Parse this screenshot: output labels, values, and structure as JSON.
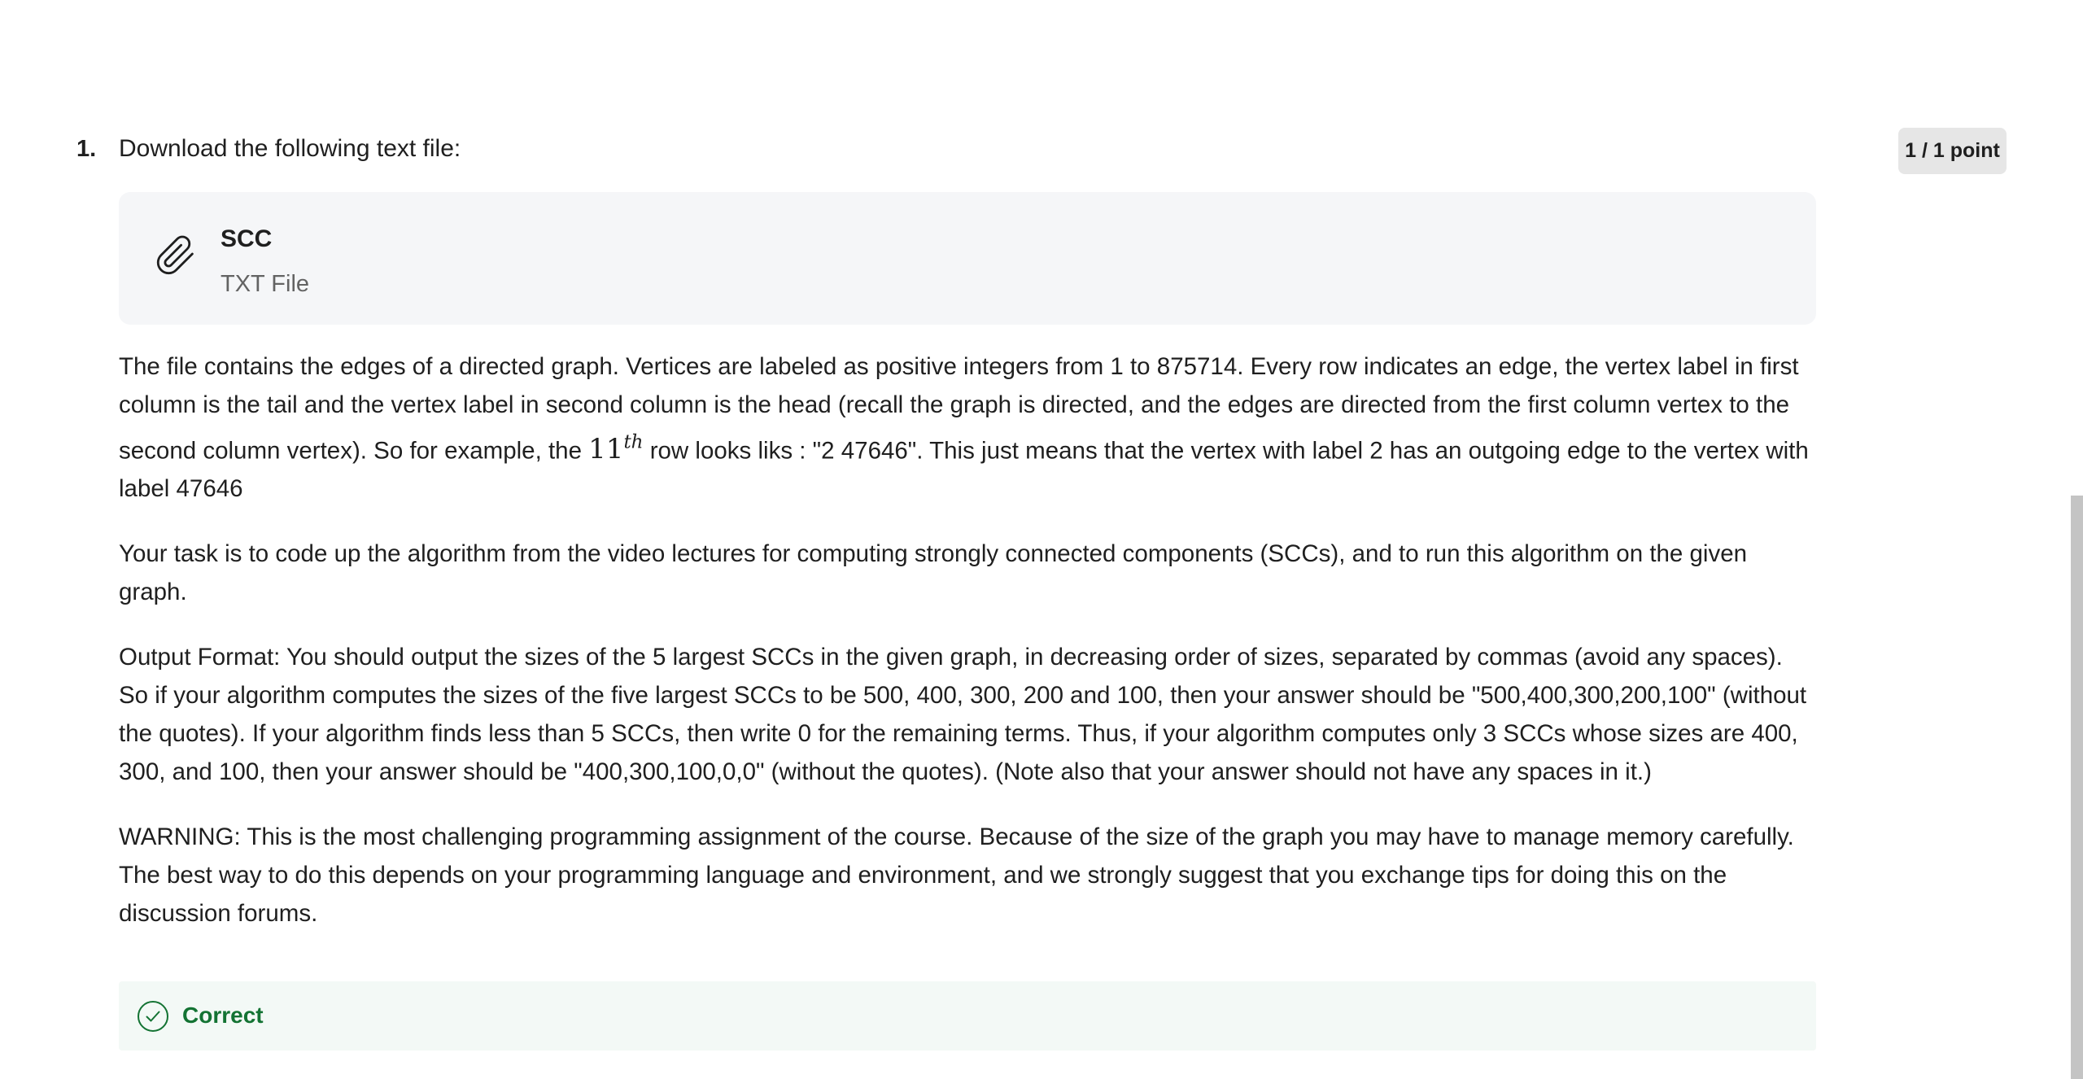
{
  "question": {
    "number": "1.",
    "points": "1 / 1 point",
    "prompt": "Download the following text file:",
    "attachment": {
      "title": "SCC",
      "type": "TXT File",
      "icon": "paperclip-icon"
    },
    "paragraphs": {
      "p1_part1": "The file contains the edges of a directed graph. Vertices are labeled as positive integers from 1 to 875714. Every row indicates an edge, the vertex label in first column is the tail and the vertex label in second column is the head (recall the graph is directed, and the edges are directed from the first column vertex to the second column vertex). So for example, the ",
      "p1_math_base": "11",
      "p1_math_sup": "th",
      "p1_part2": " row looks liks : \"2 47646\". This just means that the vertex with label 2 has an outgoing edge to the vertex with label 47646",
      "p2": "Your task is to code up the algorithm from the video lectures for computing strongly connected components (SCCs), and to run this algorithm on the given graph.",
      "p3": "Output Format: You should output the sizes of the 5 largest SCCs in the given graph, in decreasing order of sizes, separated by commas (avoid any spaces). So if your algorithm computes the sizes of the five largest SCCs to be 500, 400, 300, 200 and 100, then your answer should be \"500,400,300,200,100\" (without the quotes). If your algorithm finds less than 5 SCCs, then write 0 for the remaining terms. Thus, if your algorithm computes only 3 SCCs whose sizes are 400, 300, and 100, then your answer should be \"400,300,100,0,0\" (without the quotes).  (Note also that your answer should not have any spaces in it.)",
      "p4": "WARNING: This is the most challenging programming assignment of the course. Because of the size of the graph you may have to manage memory carefully. The best way to do this depends on your programming language and environment, and we strongly suggest that you exchange tips for doing this on the discussion forums."
    },
    "feedback": {
      "label": "Correct",
      "icon": "check-circle-icon",
      "color": "#137333"
    }
  }
}
